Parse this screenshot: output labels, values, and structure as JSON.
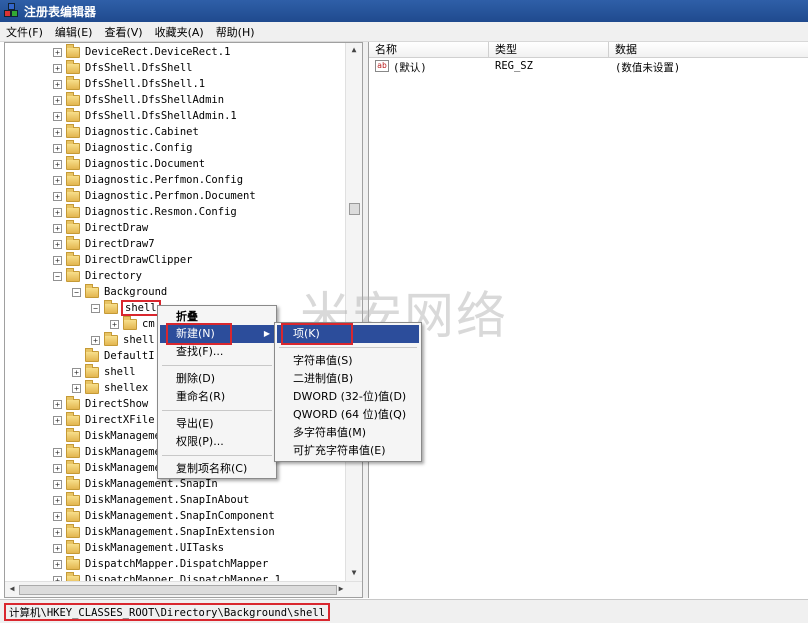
{
  "window": {
    "title": "注册表编辑器"
  },
  "menubar": [
    "文件(F)",
    "编辑(E)",
    "查看(V)",
    "收藏夹(A)",
    "帮助(H)"
  ],
  "tree": [
    {
      "label": "DeviceRect.DeviceRect.1",
      "indent": 0,
      "exp": "+"
    },
    {
      "label": "DfsShell.DfsShell",
      "indent": 0,
      "exp": "+"
    },
    {
      "label": "DfsShell.DfsShell.1",
      "indent": 0,
      "exp": "+"
    },
    {
      "label": "DfsShell.DfsShellAdmin",
      "indent": 0,
      "exp": "+"
    },
    {
      "label": "DfsShell.DfsShellAdmin.1",
      "indent": 0,
      "exp": "+"
    },
    {
      "label": "Diagnostic.Cabinet",
      "indent": 0,
      "exp": "+"
    },
    {
      "label": "Diagnostic.Config",
      "indent": 0,
      "exp": "+"
    },
    {
      "label": "Diagnostic.Document",
      "indent": 0,
      "exp": "+"
    },
    {
      "label": "Diagnostic.Perfmon.Config",
      "indent": 0,
      "exp": "+"
    },
    {
      "label": "Diagnostic.Perfmon.Document",
      "indent": 0,
      "exp": "+"
    },
    {
      "label": "Diagnostic.Resmon.Config",
      "indent": 0,
      "exp": "+"
    },
    {
      "label": "DirectDraw",
      "indent": 0,
      "exp": "+"
    },
    {
      "label": "DirectDraw7",
      "indent": 0,
      "exp": "+"
    },
    {
      "label": "DirectDrawClipper",
      "indent": 0,
      "exp": "+"
    },
    {
      "label": "Directory",
      "indent": 0,
      "exp": "-"
    },
    {
      "label": "Background",
      "indent": 1,
      "exp": "-"
    },
    {
      "label": "shell",
      "indent": 2,
      "exp": "-",
      "selected": true
    },
    {
      "label": "cm",
      "indent": 3,
      "exp": "+"
    },
    {
      "label": "shell",
      "indent": 2,
      "exp": "+"
    },
    {
      "label": "DefaultI",
      "indent": 1,
      "exp": ""
    },
    {
      "label": "shell",
      "indent": 1,
      "exp": "+"
    },
    {
      "label": "shellex",
      "indent": 1,
      "exp": "+"
    },
    {
      "label": "DirectShow",
      "indent": 0,
      "exp": "+"
    },
    {
      "label": "DirectXFile",
      "indent": 0,
      "exp": "+"
    },
    {
      "label": "DiskManageme",
      "indent": 0,
      "exp": ""
    },
    {
      "label": "DiskManageme",
      "indent": 0,
      "exp": "+"
    },
    {
      "label": "DiskManageme",
      "indent": 0,
      "exp": "+"
    },
    {
      "label": "DiskManagement.SnapIn",
      "indent": 0,
      "exp": "+"
    },
    {
      "label": "DiskManagement.SnapInAbout",
      "indent": 0,
      "exp": "+"
    },
    {
      "label": "DiskManagement.SnapInComponent",
      "indent": 0,
      "exp": "+"
    },
    {
      "label": "DiskManagement.SnapInExtension",
      "indent": 0,
      "exp": "+"
    },
    {
      "label": "DiskManagement.UITasks",
      "indent": 0,
      "exp": "+"
    },
    {
      "label": "DispatchMapper.DispatchMapper",
      "indent": 0,
      "exp": "+"
    },
    {
      "label": "DispatchMapper.DispatchMapper.1",
      "indent": 0,
      "exp": "+"
    }
  ],
  "values_header": {
    "name": "名称",
    "type": "类型",
    "data": "数据"
  },
  "values": [
    {
      "name": "(默认)",
      "type": "REG_SZ",
      "data": "(数值未设置)",
      "icon": "ab"
    }
  ],
  "context_menu": {
    "collapse": "折叠",
    "new": "新建(N)",
    "find": "查找(F)...",
    "delete": "删除(D)",
    "rename": "重命名(R)",
    "export": "导出(E)",
    "permissions": "权限(P)...",
    "copy_key_name": "复制项名称(C)"
  },
  "submenu": {
    "key": "项(K)",
    "string": "字符串值(S)",
    "binary": "二进制值(B)",
    "dword": "DWORD (32-位)值(D)",
    "qword": "QWORD (64 位)值(Q)",
    "multi_string": "多字符串值(M)",
    "expand_string": "可扩充字符串值(E)"
  },
  "watermark": "米安网络",
  "statusbar": {
    "path": "计算机\\HKEY_CLASSES_ROOT\\Directory\\Background\\shell"
  },
  "colors": {
    "highlight": "#2c4d9b",
    "annotation": "#d9272e",
    "titlebar": "#2f5fa8"
  }
}
